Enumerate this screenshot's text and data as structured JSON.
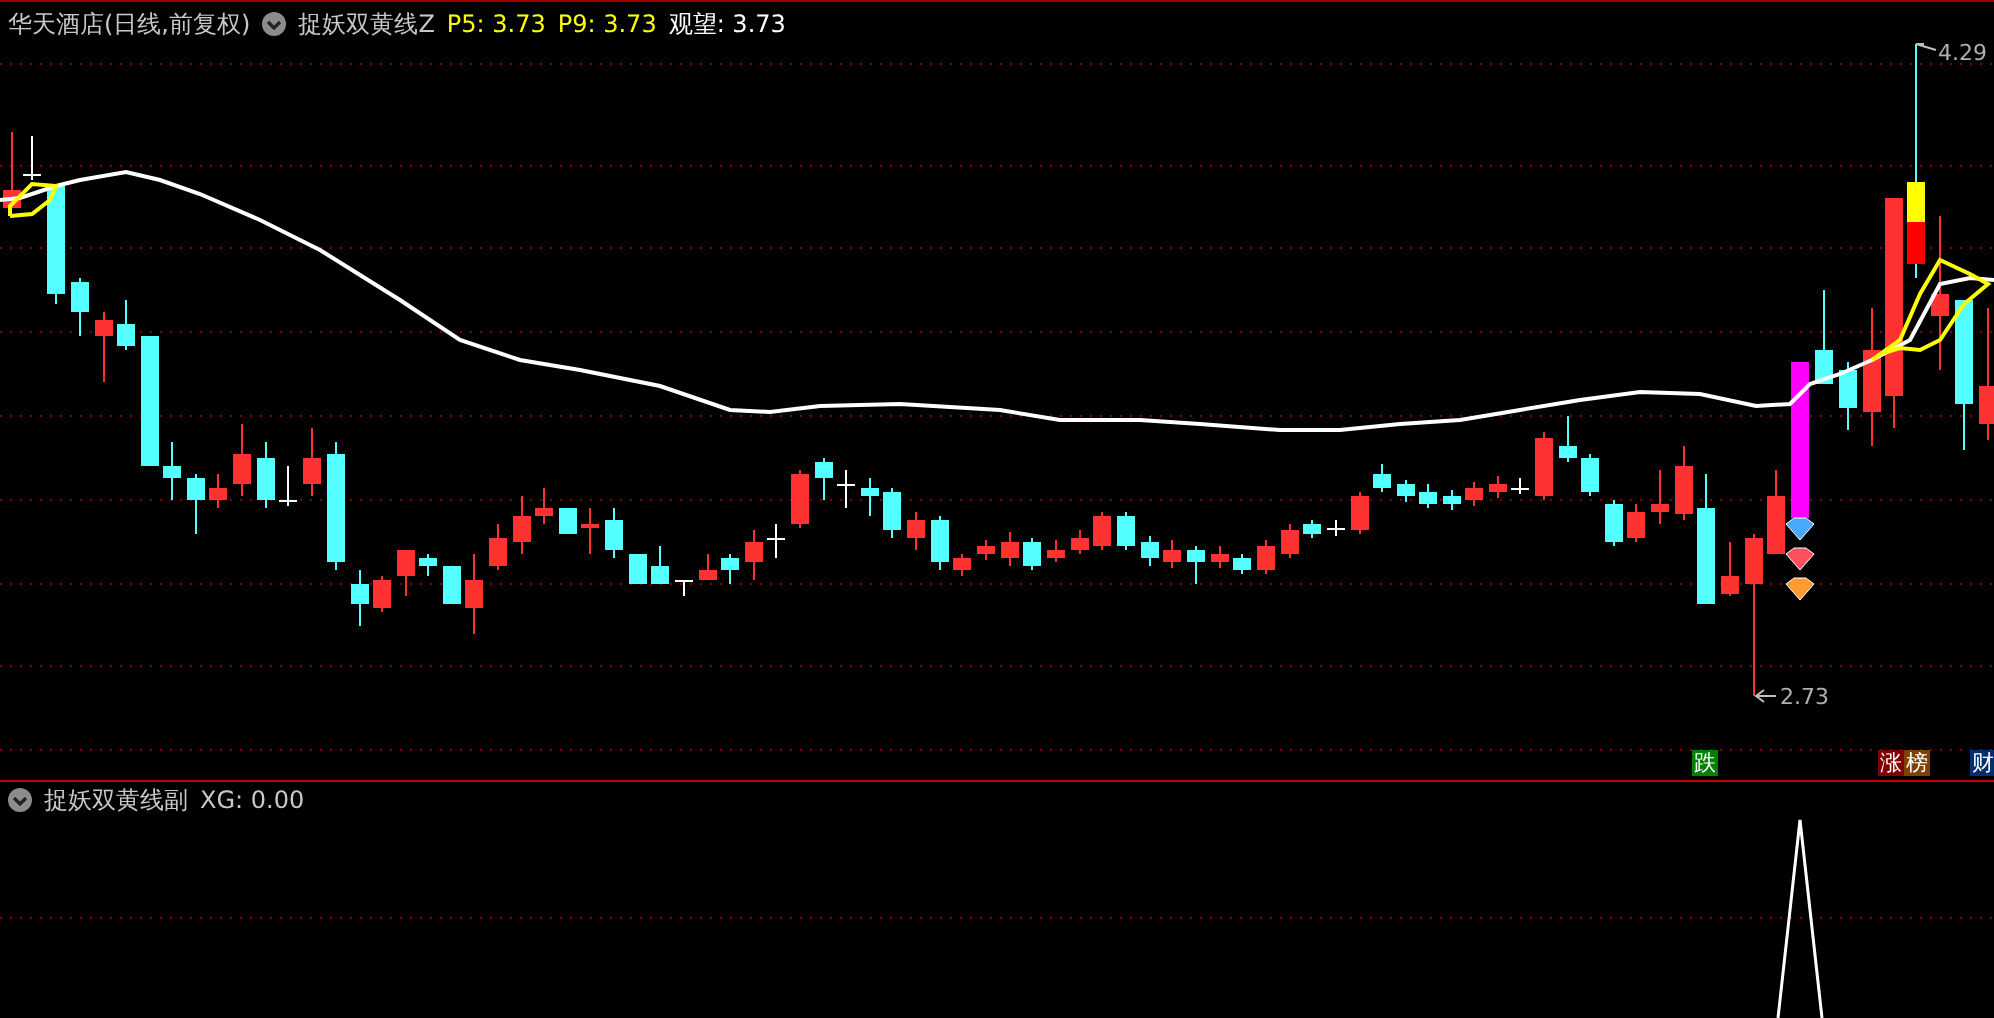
{
  "header": {
    "stock": "华天酒店(日线,前复权)",
    "indicator": "捉妖双黄线Z",
    "values": [
      {
        "label": "P5:",
        "value": "3.73",
        "color": "#ffff00"
      },
      {
        "label": "P9:",
        "value": "3.73",
        "color": "#ffff00"
      },
      {
        "label": "观望:",
        "value": "3.73",
        "color": "#ffffff"
      }
    ]
  },
  "price_labels": {
    "high": "4.29",
    "low": "2.73"
  },
  "markers": [
    {
      "text": "跌",
      "color": "#008000"
    },
    {
      "text": "涨",
      "color": "#800000"
    },
    {
      "text": "榜",
      "color": "#804000"
    },
    {
      "text": "财",
      "color": "#003070"
    }
  ],
  "sub_panel": {
    "indicator": "捉妖双黄线副",
    "readout": "XG: 0.00"
  }
}
